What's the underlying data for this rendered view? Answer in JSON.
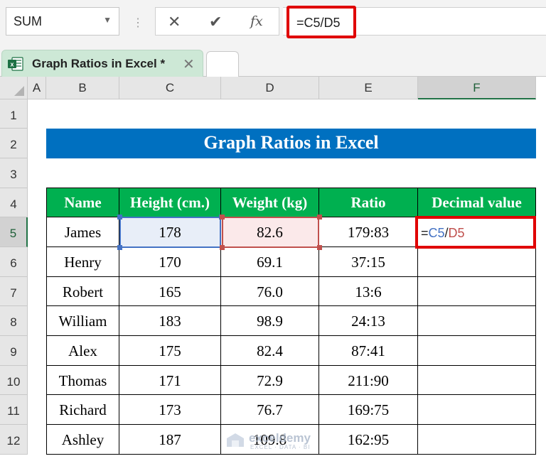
{
  "formula_bar": {
    "name_box": "SUM",
    "cancel_glyph": "✕",
    "enter_glyph": "✔",
    "fx_label": "fx",
    "formula": "=C5/D5",
    "separator": "⋮"
  },
  "tabs": {
    "active_title": "Graph Ratios in Excel *",
    "close_glyph": "✕"
  },
  "grid": {
    "columns": [
      "A",
      "B",
      "C",
      "D",
      "E",
      "F"
    ],
    "active_column": "F",
    "rows": [
      "1",
      "2",
      "3",
      "4",
      "5",
      "6",
      "7",
      "8",
      "9",
      "10",
      "11",
      "12"
    ],
    "active_row": "5"
  },
  "sheet": {
    "banner_title": "Graph Ratios in Excel",
    "table": {
      "headers": [
        "Name",
        "Height (cm.)",
        "Weight (kg)",
        "Ratio",
        "Decimal value"
      ],
      "rows": [
        [
          "James",
          "178",
          "82.6",
          "179:83",
          ""
        ],
        [
          "Henry",
          "170",
          "69.1",
          "37:15",
          ""
        ],
        [
          "Robert",
          "165",
          "76.0",
          "13:6",
          ""
        ],
        [
          "William",
          "183",
          "98.9",
          "24:13",
          ""
        ],
        [
          "Alex",
          "175",
          "82.4",
          "87:41",
          ""
        ],
        [
          "Thomas",
          "171",
          "72.9",
          "211:90",
          ""
        ],
        [
          "Richard",
          "173",
          "76.7",
          "169:75",
          ""
        ],
        [
          "Ashley",
          "187",
          "109.8",
          "162:95",
          ""
        ]
      ]
    },
    "editing_cell": {
      "eq": "=",
      "ref1": "C5",
      "op": "/",
      "ref2": "D5"
    }
  },
  "watermark": {
    "name": "exceldemy",
    "tagline": "EXCEL · DATA · BI"
  },
  "colors": {
    "accent_green": "#217346",
    "header_fill": "#00b050",
    "banner_fill": "#0070c0",
    "highlight_red": "#e00000"
  }
}
